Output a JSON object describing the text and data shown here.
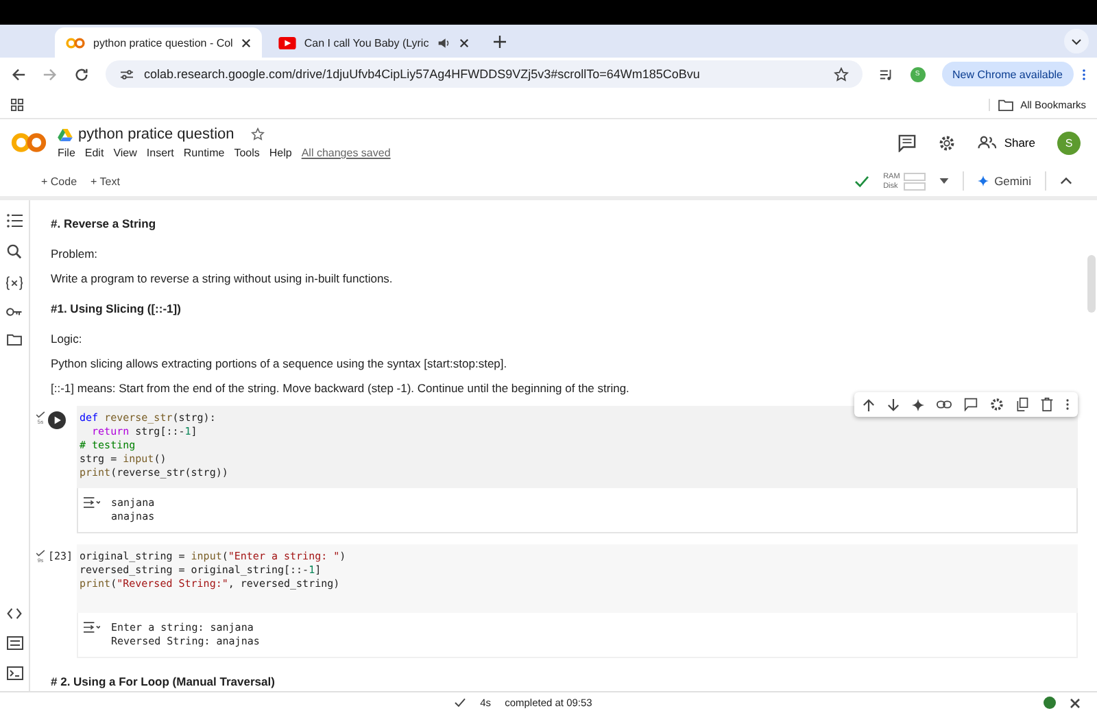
{
  "browser": {
    "tabs": [
      {
        "title": "python pratice question - Col",
        "selected": true,
        "kind": "colab",
        "audio": false
      },
      {
        "title": "Can I call You Baby (Lyric",
        "selected": false,
        "kind": "video",
        "audio": true
      }
    ],
    "url": "colab.research.google.com/drive/1djuUfvb4CipLiy57Ag4HFWDDS9VZj5v3#scrollTo=64Wm185CoBvu",
    "profile": "S",
    "update_button": "New Chrome available",
    "bookmarks": "All Bookmarks"
  },
  "notebook": {
    "title": "python pratice question",
    "menu": [
      "File",
      "Edit",
      "View",
      "Insert",
      "Runtime",
      "Tools",
      "Help"
    ],
    "save_status": "All changes saved",
    "share": "Share",
    "avatar": "S",
    "add_code": "+ Code",
    "add_text": "+ Text",
    "ram": "RAM",
    "disk": "Disk",
    "gemini": "Gemini"
  },
  "cells": [
    {
      "kind": "heading",
      "text": "#. Reverse a String"
    },
    {
      "kind": "para",
      "text": "Problem:"
    },
    {
      "kind": "para",
      "text": "Write a program to reverse a string without using in-built functions."
    },
    {
      "kind": "heading",
      "text": "#1. Using Slicing ([::-1])"
    },
    {
      "kind": "para",
      "text": "Logic:"
    },
    {
      "kind": "para",
      "text": "Python slicing allows extracting portions of a sequence using the syntax [start:stop:step]."
    },
    {
      "kind": "para",
      "text": "[::-1] means: Start from the end of the string. Move backward (step -1). Continue until the beginning of the string."
    },
    {
      "kind": "code",
      "focused": true,
      "time": "5s",
      "lines": [
        [
          {
            "kind": "keyword",
            "text": "def "
          },
          {
            "kind": "function",
            "text": "reverse_str"
          },
          {
            "kind": "plain",
            "text": "(strg):"
          }
        ],
        [
          {
            "kind": "keyword2",
            "text": "  return "
          },
          {
            "kind": "plain",
            "text": "strg[::-"
          },
          {
            "kind": "number",
            "text": "1"
          },
          {
            "kind": "plain",
            "text": "]"
          }
        ],
        [
          {
            "kind": "comment",
            "text": "# testing"
          }
        ],
        [
          {
            "kind": "plain",
            "text": "strg = "
          },
          {
            "kind": "function",
            "text": "input"
          },
          {
            "kind": "plain",
            "text": "()"
          }
        ],
        [
          {
            "kind": "function",
            "text": "print"
          },
          {
            "kind": "plain",
            "text": "(reverse_str(strg))"
          }
        ]
      ],
      "output": [
        "sanjana",
        "anajnas"
      ]
    },
    {
      "kind": "code",
      "focused": false,
      "exec": "[23]",
      "time": "9s",
      "lines": [
        [
          {
            "kind": "plain",
            "text": "original_string = "
          },
          {
            "kind": "function",
            "text": "input"
          },
          {
            "kind": "plain",
            "text": "("
          },
          {
            "kind": "string",
            "text": "\"Enter a string: \""
          },
          {
            "kind": "plain",
            "text": ")"
          }
        ],
        [
          {
            "kind": "plain",
            "text": "reversed_string = original_string[::-"
          },
          {
            "kind": "number",
            "text": "1"
          },
          {
            "kind": "plain",
            "text": "]"
          }
        ],
        [
          {
            "kind": "function",
            "text": "print"
          },
          {
            "kind": "plain",
            "text": "("
          },
          {
            "kind": "string",
            "text": "\"Reversed String:\""
          },
          {
            "kind": "plain",
            "text": ", reversed_string)"
          }
        ]
      ],
      "output": [
        "Enter a string: sanjana",
        "Reversed String: anajnas"
      ]
    },
    {
      "kind": "heading",
      "text": "# 2. Using a For Loop (Manual Traversal)"
    }
  ],
  "status": {
    "duration": "4s",
    "completed": "completed at 09:53"
  }
}
